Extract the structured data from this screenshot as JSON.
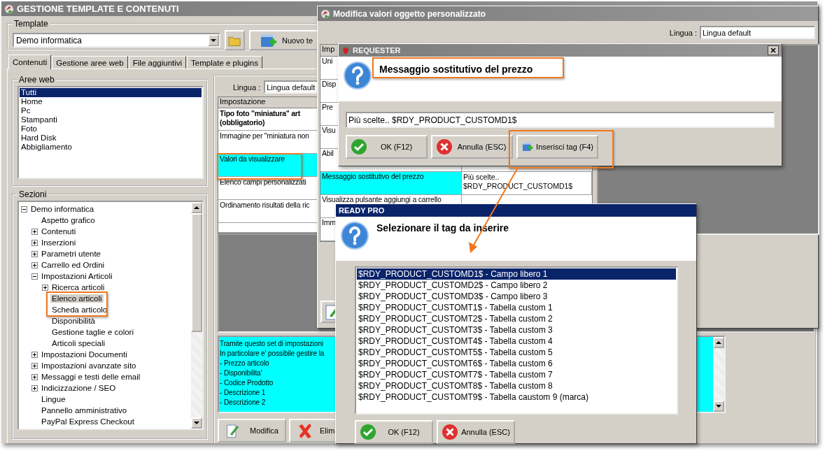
{
  "main_window": {
    "title": "GESTIONE TEMPLATE E CONTENUTI",
    "template": {
      "label": "Template",
      "value": "Demo informatica",
      "new_button": "Nuovo te"
    },
    "tabs": [
      {
        "label": "Contenuti",
        "selected": true
      },
      {
        "label": "Gestione aree web",
        "selected": false
      },
      {
        "label": "File aggiuntivi",
        "selected": false
      },
      {
        "label": "Template e plugins",
        "selected": false
      }
    ],
    "web_areas": {
      "label": "Aree web",
      "items": [
        {
          "label": "Tutti",
          "selected": true
        },
        {
          "label": "Home",
          "selected": false
        },
        {
          "label": "Pc",
          "selected": false
        },
        {
          "label": "Stampanti",
          "selected": false
        },
        {
          "label": "Foto",
          "selected": false
        },
        {
          "label": "Hard Disk",
          "selected": false
        },
        {
          "label": "Abbigliamento",
          "selected": false
        }
      ]
    },
    "sections": {
      "label": "Sezioni",
      "tree": [
        {
          "label": "Demo informatica",
          "selected": false,
          "expanded": true,
          "children": [
            {
              "label": "Aspetto grafico",
              "selected": false
            },
            {
              "label": "Contenuti",
              "selected": false,
              "expanded": false
            },
            {
              "label": "Inserzioni",
              "selected": false,
              "expanded": false
            },
            {
              "label": "Parametri utente",
              "selected": false,
              "expanded": false
            },
            {
              "label": "Carrello ed Ordini",
              "selected": false,
              "expanded": false
            },
            {
              "label": "Impostazioni Articoli",
              "selected": false,
              "expanded": true,
              "children": [
                {
                  "label": "Ricerca articoli",
                  "selected": false,
                  "expanded": false
                },
                {
                  "label": "Elenco articoli",
                  "selected": true
                },
                {
                  "label": "Scheda articolo",
                  "selected": false
                },
                {
                  "label": "Disponibilità",
                  "selected": false
                },
                {
                  "label": "Gestione taglie e colori",
                  "selected": false
                },
                {
                  "label": "Articoli speciali",
                  "selected": false
                }
              ]
            },
            {
              "label": "Impostazioni Documenti",
              "selected": false,
              "expanded": false
            },
            {
              "label": "Impostazioni avanzate sito",
              "selected": false,
              "expanded": false
            },
            {
              "label": "Messaggi e testi delle email",
              "selected": false,
              "expanded": false
            },
            {
              "label": "Indicizzazione / SEO",
              "selected": false,
              "expanded": false
            },
            {
              "label": "Lingue",
              "selected": false
            },
            {
              "label": "Pannello amministrativo",
              "selected": false
            },
            {
              "label": "PayPal Express Checkout",
              "selected": false
            }
          ]
        }
      ]
    },
    "language": {
      "label": "Lingua :",
      "value": "Lingua default"
    },
    "settings_table": {
      "header": "Impostazione",
      "rows": [
        {
          "lines": [
            "Tipo foto \"miniatura\" art",
            "(obbligatorio)"
          ],
          "kind": "required",
          "selected": false
        },
        {
          "lines": [
            "Immagine per \"miniatura non"
          ],
          "kind": "optional",
          "selected": false
        },
        {
          "lines": [
            "Valori da visualizzare"
          ],
          "kind": "optional",
          "selected": true
        },
        {
          "lines": [
            "Elenco campi personalizzati"
          ],
          "kind": "optional",
          "selected": false
        },
        {
          "lines": [
            "Ordinamento risultati della ric"
          ],
          "kind": "optional",
          "selected": false
        }
      ]
    },
    "description": {
      "lines": [
        "Tramite questo set di impostazioni",
        "In particolare e' possibile gestire la",
        "- Prezzo articolo",
        "- Disponibilita'",
        "- Codice Prodotto",
        "- Descrizione 1",
        "- Descrizione 2"
      ]
    },
    "buttons": [
      {
        "label": "Modifica",
        "kind": "edit"
      },
      {
        "label": "Elim",
        "kind": "delete"
      }
    ]
  },
  "edit_dialog": {
    "title": "Modifica valori oggetto personalizzato",
    "language": {
      "label": "Lingua :",
      "value": "Lingua default"
    },
    "table": {
      "header": "Imp",
      "rows": [
        {
          "label": "Uni",
          "selected": false
        },
        {
          "label": "Disp",
          "selected": false
        },
        {
          "label": "Pre",
          "selected": false
        },
        {
          "label": "Visu",
          "selected": false
        },
        {
          "label": "Abil",
          "selected": false
        },
        {
          "label": "Messaggio sostitutivo del prezzo",
          "value": "Più scelte.. $RDY_PRODUCT_CUSTOMD1$",
          "selected": true
        },
        {
          "label": "Visualizza pulsante aggiungi a carrello",
          "selected": false
        },
        {
          "label": "Imm",
          "selected": false
        }
      ]
    }
  },
  "requester": {
    "title": "REQUESTER",
    "message": "Messaggio sostitutivo del prezzo",
    "value": "Più scelte.. $RDY_PRODUCT_CUSTOMD1$",
    "buttons": [
      {
        "label": "OK (F12)",
        "kind": "ok"
      },
      {
        "label": "Annulla (ESC)",
        "kind": "cancel"
      },
      {
        "label": "Inserisci tag (F4)",
        "kind": "insert"
      }
    ]
  },
  "tag_dialog": {
    "title": "READY PRO",
    "message": "Selezionare il tag da inserire",
    "tags": [
      {
        "label": "$RDY_PRODUCT_CUSTOMD1$ - Campo libero 1",
        "selected": true
      },
      {
        "label": "$RDY_PRODUCT_CUSTOMD2$ - Campo libero 2",
        "selected": false
      },
      {
        "label": "$RDY_PRODUCT_CUSTOMD3$ - Campo libero 3",
        "selected": false
      },
      {
        "label": "$RDY_PRODUCT_CUSTOMT1$ - Tabella custom 1",
        "selected": false
      },
      {
        "label": "$RDY_PRODUCT_CUSTOMT2$ - Tabella custom 2",
        "selected": false
      },
      {
        "label": "$RDY_PRODUCT_CUSTOMT3$ - Tabella custom 3",
        "selected": false
      },
      {
        "label": "$RDY_PRODUCT_CUSTOMT4$ - Tabella custom 4",
        "selected": false
      },
      {
        "label": "$RDY_PRODUCT_CUSTOMT5$ - Tabella custom 5",
        "selected": false
      },
      {
        "label": "$RDY_PRODUCT_CUSTOMT6$ - Tabella custom 6",
        "selected": false
      },
      {
        "label": "$RDY_PRODUCT_CUSTOMT7$ - Tabella custom 7",
        "selected": false
      },
      {
        "label": "$RDY_PRODUCT_CUSTOMT8$ - Tabella custom 8",
        "selected": false
      },
      {
        "label": "$RDY_PRODUCT_CUSTOMT9$ - Tabella caustom 9 (marca)",
        "selected": false
      }
    ],
    "buttons": [
      {
        "label": "OK (F12)",
        "kind": "ok"
      },
      {
        "label": "Annulla (ESC)",
        "kind": "cancel"
      }
    ]
  }
}
